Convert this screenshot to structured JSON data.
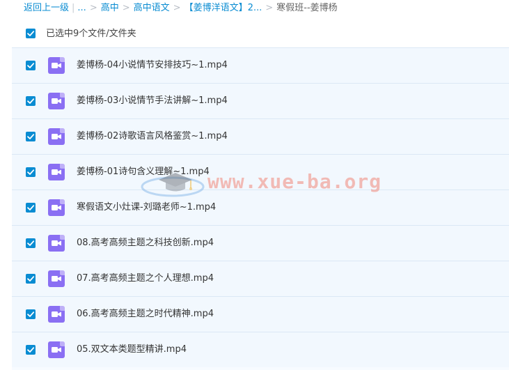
{
  "breadcrumb": {
    "back_label": "返回上一级",
    "ellipsis": "...",
    "items": [
      "高中",
      "高中语文",
      "【姜博洋语文】2..."
    ],
    "current": "寒假班--姜博杨"
  },
  "selection": {
    "label": "已选中9个文件/文件夹"
  },
  "files": [
    {
      "name": "姜博杨-04小说情节安排技巧~1.mp4"
    },
    {
      "name": "姜博杨-03小说情节手法讲解~1.mp4"
    },
    {
      "name": "姜博杨-02诗歌语言风格鉴赏~1.mp4"
    },
    {
      "name": "姜博杨-01诗句含义理解~1.mp4"
    },
    {
      "name": "寒假语文小灶课-刘璐老师~1.mp4"
    },
    {
      "name": "08.高考高频主题之科技创新.mp4"
    },
    {
      "name": "07.高考高频主题之个人理想.mp4"
    },
    {
      "name": "06.高考高频主题之时代精神.mp4"
    },
    {
      "name": "05.双文本类题型精讲.mp4"
    }
  ],
  "watermark": {
    "text": "www.xue-ba.org"
  },
  "colors": {
    "accent": "#0a8cd2",
    "video_icon": "#8a6ff3",
    "row_bg": "#f2f8fe",
    "row_border": "#dbe8f5",
    "watermark": "#f08778"
  },
  "icons": {
    "checkbox": "checkbox-checked-icon",
    "file": "video-file-icon",
    "watermark_logo": "graduation-cap-icon"
  }
}
